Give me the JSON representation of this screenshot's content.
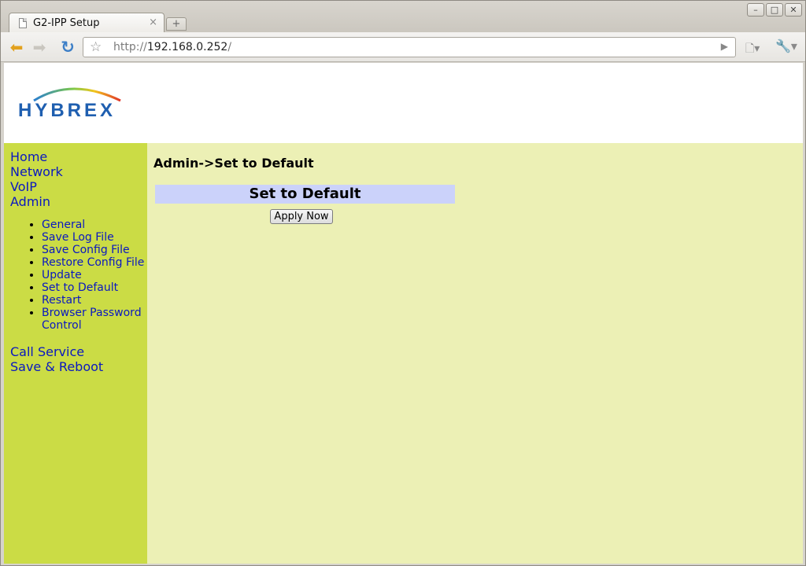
{
  "browser": {
    "tab_title": "G2-IPP Setup",
    "tab_close": "×",
    "new_tab": "+",
    "url_scheme": "http://",
    "url_host": "192.168.0.252",
    "url_path": "/"
  },
  "logo": {
    "text": "HYBREX"
  },
  "sidebar": {
    "top_links": [
      "Home",
      "Network",
      "VoIP",
      "Admin"
    ],
    "admin_items": [
      "General",
      "Save Log File",
      "Save Config File",
      "Restore Config File",
      "Update",
      "Set to Default",
      "Restart",
      "Browser Password Control"
    ],
    "bottom_links": [
      "Call Service",
      "Save & Reboot"
    ]
  },
  "main": {
    "breadcrumb": "Admin->Set to Default",
    "section_title": "Set to Default",
    "apply_button": "Apply Now"
  },
  "colors": {
    "sidebar_bg": "#cbdc45",
    "main_bg": "#ecf0b5",
    "section_bar": "#cbd2fa",
    "link": "#0a18c0",
    "logo_blue": "#1f5fb0"
  }
}
